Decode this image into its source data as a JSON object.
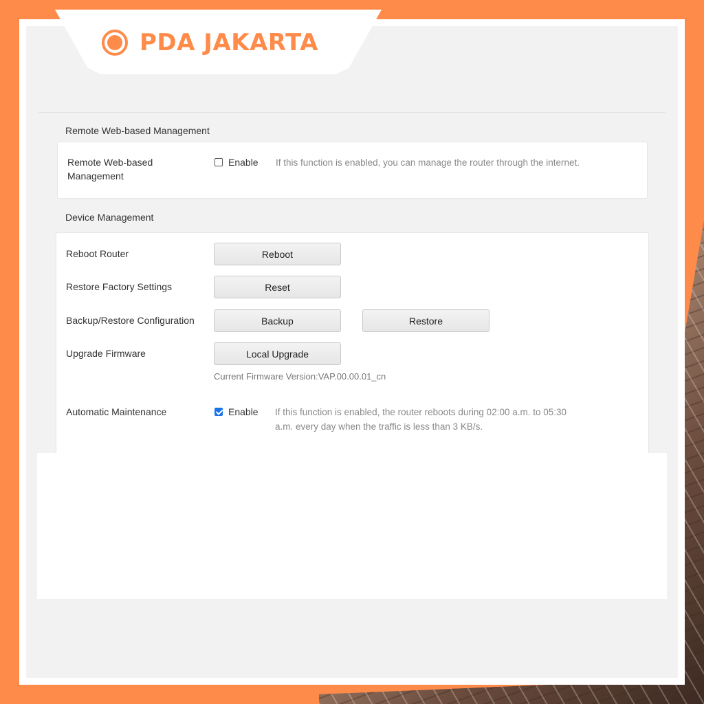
{
  "brand": {
    "name": "PDA JAKARTA",
    "color": "#ff8b4a"
  },
  "remote": {
    "section_title": "Remote Web-based Management",
    "label": "Remote Web-based Management",
    "checkbox_label": "Enable",
    "checked": false,
    "help": "If this function is enabled, you can manage the router through the internet."
  },
  "device": {
    "section_title": "Device Management",
    "reboot": {
      "label": "Reboot Router",
      "button": "Reboot"
    },
    "reset": {
      "label": "Restore Factory Settings",
      "button": "Reset"
    },
    "backup": {
      "label": "Backup/Restore Configuration",
      "backup_button": "Backup",
      "restore_button": "Restore"
    },
    "upgrade": {
      "label": "Upgrade Firmware",
      "button": "Local Upgrade",
      "firmware_version": "Current Firmware Version:VAP.00.00.01_cn"
    },
    "maintenance": {
      "label": "Automatic Maintenance",
      "checkbox_label": "Enable",
      "checked": true,
      "help": "If this function is enabled, the router reboots during 02:00 a.m. to 05:30 a.m. every day when the traffic is less than 3 KB/s."
    }
  }
}
